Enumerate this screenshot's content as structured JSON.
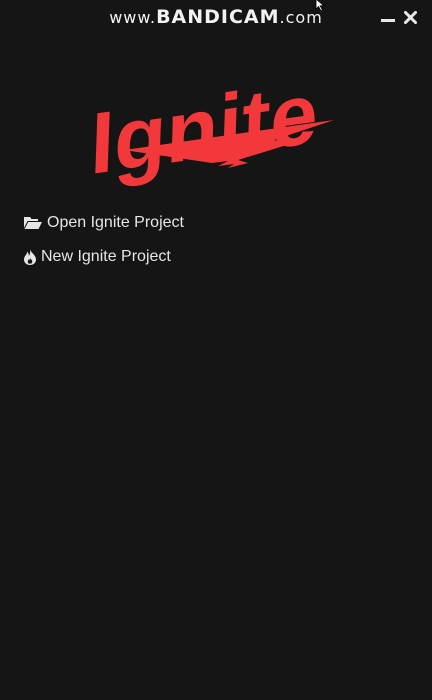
{
  "watermark": {
    "prefix": "www.",
    "brand": "BANDICAM",
    "suffix": ".com"
  },
  "window_controls": {
    "minimize_icon": "minimize-icon",
    "close_icon": "close-icon"
  },
  "logo": {
    "text": "Ignite",
    "color": "#f2383b"
  },
  "menu": {
    "items": [
      {
        "label": "Open Ignite Project",
        "icon": "folder-open-icon"
      },
      {
        "label": "New Ignite Project",
        "icon": "flame-icon"
      }
    ]
  },
  "colors": {
    "background": "#151515",
    "text": "#e6e6e6",
    "accent": "#f2383b"
  }
}
